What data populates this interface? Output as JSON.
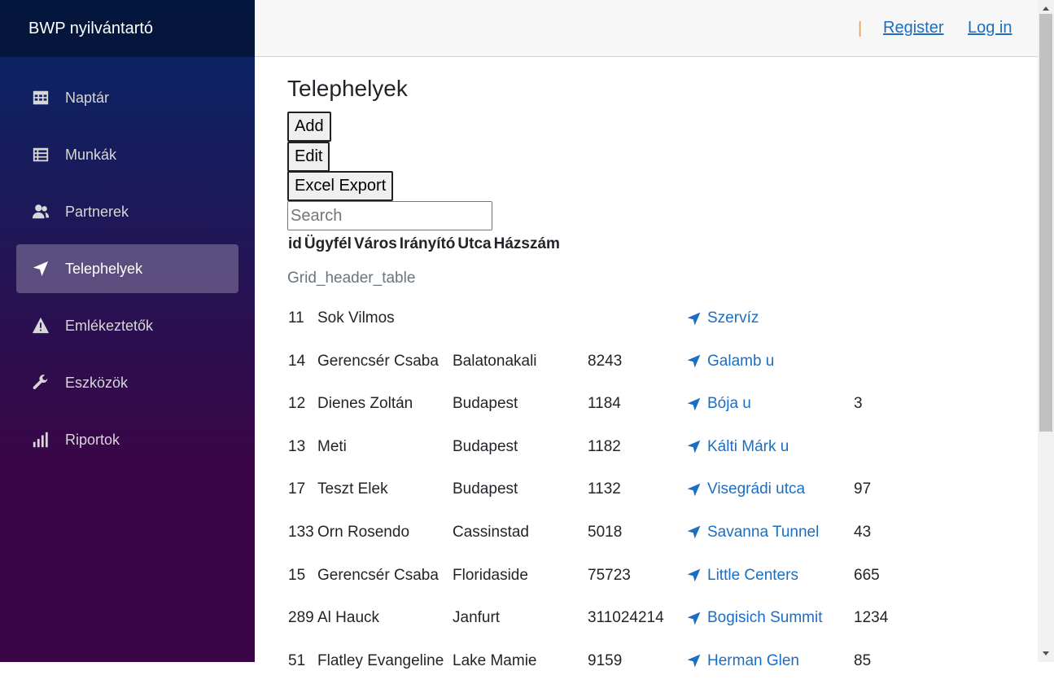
{
  "brand": "BWP nyilvántartó",
  "nav": [
    {
      "label": "Naptár",
      "icon": "calendar-icon",
      "active": false
    },
    {
      "label": "Munkák",
      "icon": "list-icon",
      "active": false
    },
    {
      "label": "Partnerek",
      "icon": "people-icon",
      "active": false
    },
    {
      "label": "Telephelyek",
      "icon": "location-arrow-icon",
      "active": true
    },
    {
      "label": "Emlékeztetők",
      "icon": "warning-icon",
      "active": false
    },
    {
      "label": "Eszközök",
      "icon": "wrench-icon",
      "active": false
    },
    {
      "label": "Riportok",
      "icon": "bar-chart-icon",
      "active": false
    }
  ],
  "topbar": {
    "separator": "|",
    "register": "Register",
    "login": "Log in"
  },
  "page": {
    "title": "Telephelyek",
    "buttons": {
      "add": "Add",
      "edit": "Edit",
      "excel": "Excel Export"
    },
    "search_placeholder": "Search",
    "headers": [
      "id",
      "Ügyfél",
      "Város",
      "Irányító",
      "Utca",
      "Házszám"
    ],
    "grid_caption": "Grid_header_table"
  },
  "rows": [
    {
      "id": "11",
      "client": "Sok Vilmos",
      "city": "",
      "zip": "",
      "street": "Szervíz",
      "house": ""
    },
    {
      "id": "14",
      "client": "Gerencsér Csaba",
      "city": "Balatonakali",
      "zip": "8243",
      "street": "Galamb u",
      "house": ""
    },
    {
      "id": "12",
      "client": "Dienes Zoltán",
      "city": "Budapest",
      "zip": "1184",
      "street": "Bója u",
      "house": "3"
    },
    {
      "id": "13",
      "client": "Meti",
      "city": "Budapest",
      "zip": "1182",
      "street": "Kálti Márk u",
      "house": ""
    },
    {
      "id": "17",
      "client": "Teszt Elek",
      "city": "Budapest",
      "zip": "1132",
      "street": "Visegrádi utca",
      "house": "97"
    },
    {
      "id": "133",
      "client": "Orn Rosendo",
      "city": "Cassinstad",
      "zip": "5018",
      "street": "Savanna Tunnel",
      "house": "43"
    },
    {
      "id": "15",
      "client": "Gerencsér Csaba",
      "city": "Floridaside",
      "zip": "75723",
      "street": "Little Centers",
      "house": "665"
    },
    {
      "id": "289",
      "client": "Al Hauck",
      "city": "Janfurt",
      "zip": "311024214",
      "street": "Bogisich Summit",
      "house": "1234"
    },
    {
      "id": "51",
      "client": "Flatley Evangeline",
      "city": "Lake Mamie",
      "zip": "9159",
      "street": "Herman Glen",
      "house": "85"
    }
  ],
  "colors": {
    "accent": "#1b6ec2",
    "sidebar_top": "#052767",
    "sidebar_bottom": "#3a0647"
  }
}
